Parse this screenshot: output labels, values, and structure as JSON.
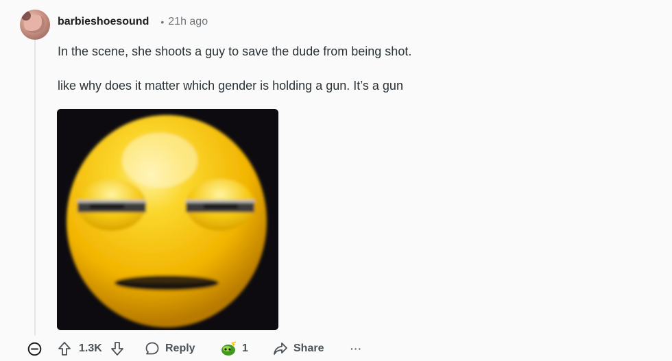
{
  "comment": {
    "username": "barbieshoesound",
    "separator": "•",
    "time_ago": "21h ago",
    "paragraphs": [
      "In the scene, she shoots a guy to save the dude from being shot.",
      "like why does it matter which gender is holding a gun. It’s a gun"
    ]
  },
  "media": {
    "icon": "meh-emoji-image"
  },
  "actions": {
    "collapse_icon": "minus-circle-icon",
    "upvote_icon": "arrow-up-icon",
    "vote_count": "1.3K",
    "downvote_icon": "arrow-down-icon",
    "reply_label": "Reply",
    "award_count": "1",
    "share_label": "Share",
    "more_label": "···"
  },
  "colors": {
    "background": "#fafafb",
    "text": "#2a3236",
    "muted": "#6e7579",
    "thread_line": "#e3e5e8",
    "emoji_yellow": "#f2c200"
  }
}
